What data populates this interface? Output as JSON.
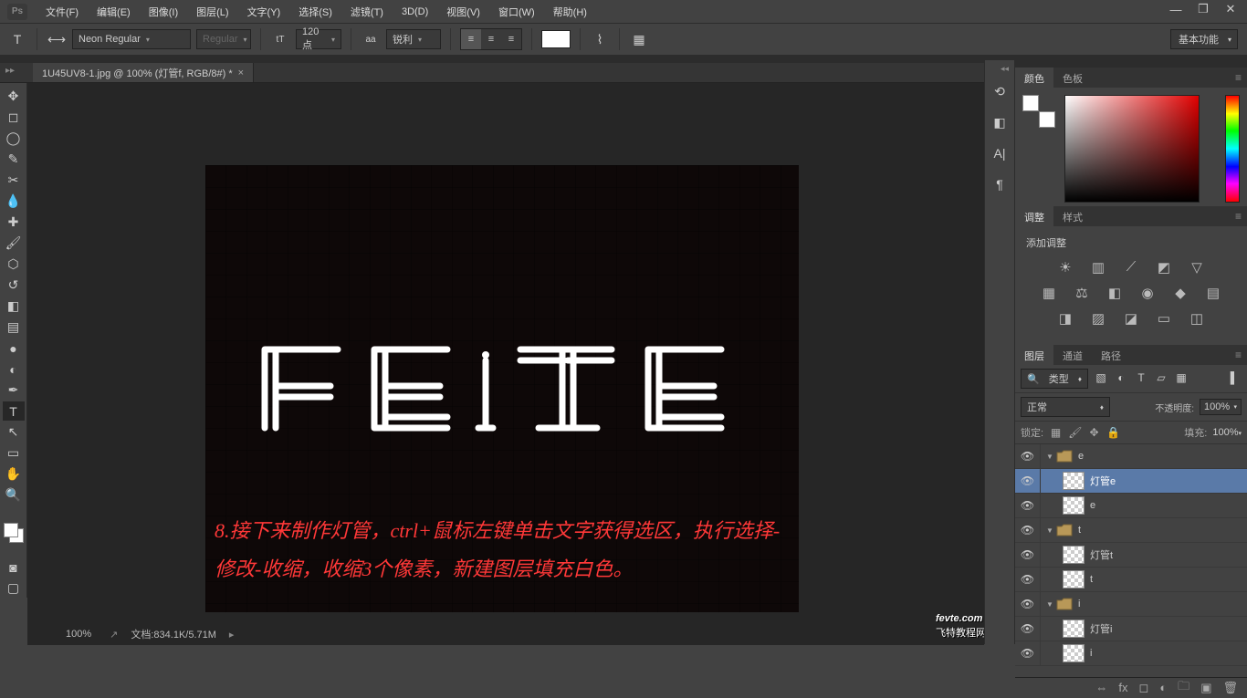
{
  "app": {
    "logo": "Ps"
  },
  "menu": [
    "文件(F)",
    "编辑(E)",
    "图像(I)",
    "图层(L)",
    "文字(Y)",
    "选择(S)",
    "滤镜(T)",
    "3D(D)",
    "视图(V)",
    "窗口(W)",
    "帮助(H)"
  ],
  "window_controls": {
    "min": "—",
    "max": "❐",
    "close": "✕"
  },
  "options": {
    "font_name": "Neon Regular",
    "font_style": "Regular",
    "font_size": "120 点",
    "aa_label": "aa",
    "anti_alias": "锐利",
    "workspace": "基本功能"
  },
  "tab": {
    "title": "1U45UV8-1.jpg @ 100% (灯管f, RGB/8#) *",
    "close": "×"
  },
  "canvas": {
    "main_text": "FEITE",
    "instruction": "8.接下来制作灯管，ctrl+鼠标左键单击文字获得选区，执行选择-修改-收缩，收缩3个像素，新建图层填充白色。",
    "watermark": "fevte.com",
    "watermark_sub": "飞特教程网"
  },
  "status": {
    "zoom": "100%",
    "doc": "文档:834.1K/5.71M"
  },
  "panels": {
    "color": {
      "tab1": "颜色",
      "tab2": "色板"
    },
    "adjustments": {
      "tab1": "调整",
      "tab2": "样式",
      "title": "添加调整"
    },
    "layers": {
      "tab1": "图层",
      "tab2": "通道",
      "tab3": "路径",
      "filter_kind": "类型",
      "blend_mode": "正常",
      "opacity_label": "不透明度:",
      "opacity_value": "100%",
      "lock_label": "锁定:",
      "fill_label": "填充:",
      "fill_value": "100%",
      "items": [
        {
          "type": "group",
          "name": "e",
          "depth": 0,
          "open": true
        },
        {
          "type": "layer",
          "name": "灯管e",
          "depth": 1,
          "selected": true
        },
        {
          "type": "layer",
          "name": "e",
          "depth": 1
        },
        {
          "type": "group",
          "name": "t",
          "depth": 0,
          "open": true
        },
        {
          "type": "layer",
          "name": "灯管t",
          "depth": 1
        },
        {
          "type": "layer",
          "name": "t",
          "depth": 1
        },
        {
          "type": "group",
          "name": "i",
          "depth": 0,
          "open": true
        },
        {
          "type": "layer",
          "name": "灯管i",
          "depth": 1
        },
        {
          "type": "layer",
          "name": "i",
          "depth": 1
        }
      ]
    }
  }
}
